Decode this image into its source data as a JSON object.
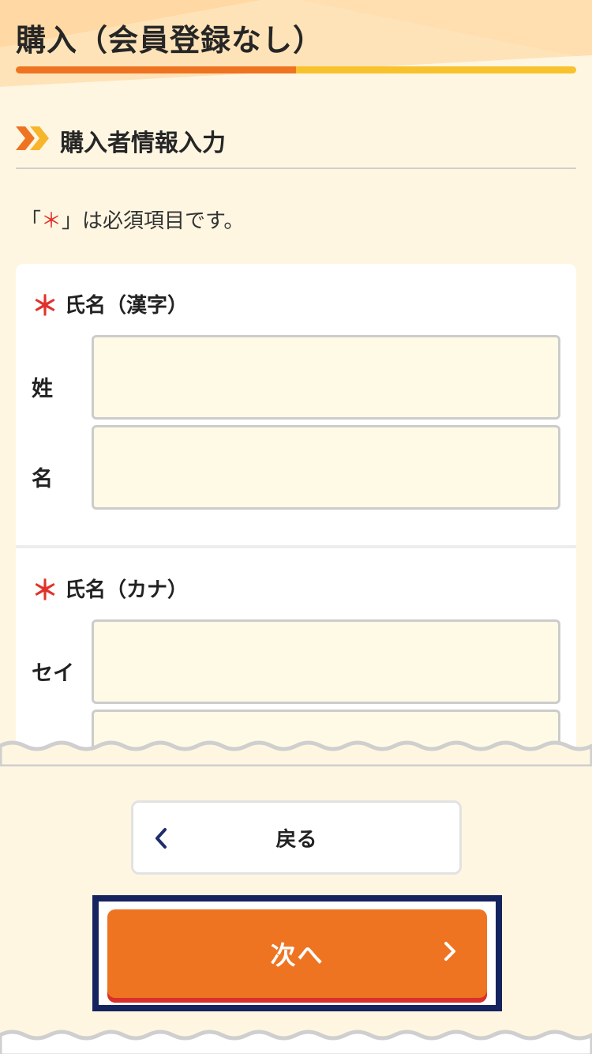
{
  "header": {
    "title": "購入（会員登録なし）",
    "progress_fraction": 0.5
  },
  "section": {
    "title": "購入者情報入力",
    "icon": "double-chevron-right-icon"
  },
  "required_note": {
    "prefix": "「",
    "star": "＊",
    "suffix": "」は必須項目です。"
  },
  "form": {
    "name_kanji": {
      "required_mark": "＊",
      "label": "氏名（漢字）",
      "last_name_label": "姓",
      "last_name_value": "",
      "first_name_label": "名",
      "first_name_value": ""
    },
    "name_kana": {
      "required_mark": "＊",
      "label": "氏名（カナ）",
      "last_name_label": "セイ",
      "last_name_value": "",
      "first_name_value": ""
    }
  },
  "buttons": {
    "back_label": "戻る",
    "back_icon": "chevron-left-icon",
    "next_label": "次へ",
    "next_icon": "chevron-right-icon"
  },
  "colors": {
    "accent_orange": "#ee7422",
    "accent_yellow": "#f7c22c",
    "required_red": "#e0322c",
    "focus_navy": "#15245e",
    "background": "#fff6e2",
    "input_bg": "#fffae6"
  }
}
